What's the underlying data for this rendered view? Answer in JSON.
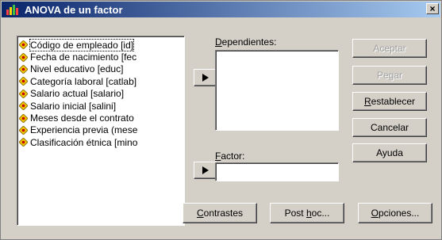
{
  "window": {
    "title": "ANOVA de un factor",
    "close_symbol": "×"
  },
  "variables": [
    "Código de empleado [id]",
    "Fecha de nacimiento [fec",
    "Nivel educativo [educ]",
    "Categoría laboral [catlab]",
    "Salario actual [salario]",
    "Salario inicial [salini]",
    "Meses desde el contrato",
    "Experiencia previa (mese",
    "Clasificación étnica [mino"
  ],
  "dependientes": {
    "label_u": "D",
    "label_rest": "ependientes:",
    "items": []
  },
  "factor": {
    "label_u": "F",
    "label_rest": "actor:",
    "value": ""
  },
  "buttons": {
    "aceptar": "Aceptar",
    "pegar_pre": "Pe",
    "pegar_u": "g",
    "pegar_post": "ar",
    "restablecer_u": "R",
    "restablecer_rest": "establecer",
    "cancelar": "Cancelar",
    "ayuda": "Ayuda",
    "contrastes_u": "C",
    "contrastes_rest": "ontrastes",
    "posthoc_pre": "Post ",
    "posthoc_u": "h",
    "posthoc_post": "oc...",
    "opciones_u": "O",
    "opciones_rest": "pciones..."
  }
}
